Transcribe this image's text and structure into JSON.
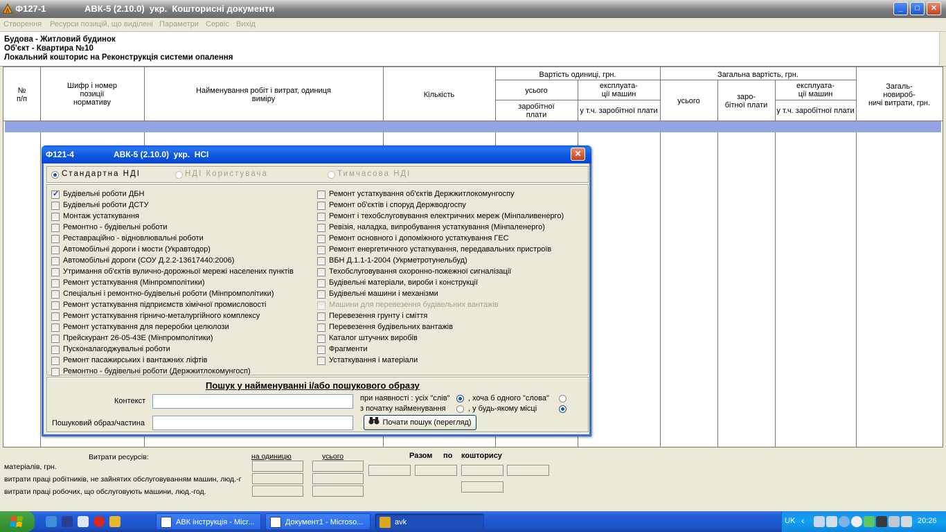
{
  "main_window": {
    "app_code": "Ф127-1",
    "title": "АВК-5 (2.10.0)  укр.  Кошторисні документи",
    "controls": {
      "minimize": "_",
      "maximize": "□",
      "close": "✕"
    }
  },
  "menu": [
    "Створення",
    "Ресурси позицій, що виділені",
    "Параметри",
    "Сервіс",
    "Вихід"
  ],
  "header": {
    "line1": "Будова - Житловий будинок",
    "line2": "Об'єкт - Квартира №10",
    "line3": "Локальний кошторис на Реконструкція системи опалення"
  },
  "table": {
    "col_num": [
      "№",
      "п/п"
    ],
    "col_code": [
      "Шифр і номер",
      "позиції",
      "нормативу"
    ],
    "col_name": [
      "Найменування робіт і витрат, одиниця",
      "виміру"
    ],
    "col_qty": "Кількість",
    "unit_cost": "Вартість одиниці, грн.",
    "total_cost": "Загальна вартість, грн.",
    "all": "усього",
    "machine_op": [
      "експлуата-",
      "ції машин"
    ],
    "wages": [
      "заробітної",
      "плати"
    ],
    "incl_wages": "у т.ч. заробітної плати",
    "total_wages": [
      "заро-",
      "бітної плати"
    ],
    "general": [
      "Загаль-",
      "новироб-",
      "ничі витрати, грн."
    ]
  },
  "resources": {
    "title": "Витрати ресурсів:",
    "per_unit": "на одиницю",
    "total": "усього",
    "rows": [
      "матеріалів, грн.",
      "витрати праці робітників, не зайнятих обслуговуванням машин, люд.-г",
      "витрати праці робочих, що обслуговують машини, люд.-год."
    ],
    "summary": [
      "Разом",
      "по",
      "кошторису"
    ]
  },
  "dialog": {
    "app_code": "Ф121-4",
    "title": "АВК-5 (2.10.0)  укр.  НСІ",
    "close": "✕",
    "sources": [
      {
        "label": "Стандартна НДІ",
        "selected": true,
        "enabled": true
      },
      {
        "label": "НДІ Користувача",
        "selected": false,
        "enabled": false
      },
      {
        "label": "Тимчасова НДІ",
        "selected": false,
        "enabled": false
      }
    ],
    "left_items": [
      {
        "label": "Будівельні роботи ДБН",
        "checked": true
      },
      {
        "label": "Будівельні роботи ДСТУ",
        "checked": false
      },
      {
        "label": "Монтаж устаткування",
        "checked": false
      },
      {
        "label": "Ремонтно - будівельні роботи",
        "checked": false
      },
      {
        "label": "Реставраційно - відновлювальні роботи",
        "checked": false
      },
      {
        "label": "Автомобільні дороги і мости (Укравтодор)",
        "checked": false
      },
      {
        "label": "Автомобільні дороги (СОУ Д.2.2-13617440:2006)",
        "checked": false
      },
      {
        "label": "Утримання об'єктів вулично-дорожньої мережі населених пунктів",
        "checked": false
      },
      {
        "label": "Ремонт устаткування (Мінпромполітики)",
        "checked": false
      },
      {
        "label": "Спеціальні і ремонтно-будівельні роботи (Мінпромполітики)",
        "checked": false
      },
      {
        "label": "Ремонт устаткування підприємств хімічної промисловості",
        "checked": false
      },
      {
        "label": "Ремонт устаткування  гірничо-металургійного комплексу",
        "checked": false
      },
      {
        "label": "Ремонт устаткування для переробки целюлози",
        "checked": false
      },
      {
        "label": "Прейскурант 26-05-43Е (Мінпромполітики)",
        "checked": false
      },
      {
        "label": "Пусконалагоджувальні роботи",
        "checked": false
      },
      {
        "label": "Ремонт пасажирських і вантажних ліфтів",
        "checked": false
      },
      {
        "label": "Ремонтно - будівельні роботи (Держжитлокомунгосп)",
        "checked": false
      }
    ],
    "right_items": [
      {
        "label": "Ремонт устаткування об'єктів Держжитлокомунгоспу",
        "checked": false,
        "enabled": true
      },
      {
        "label": "Ремонт об'єктів і споруд Держводгоспу",
        "checked": false,
        "enabled": true
      },
      {
        "label": "Ремонт і техобслуговування електричних мереж (Мінпаливенерго)",
        "checked": false,
        "enabled": true
      },
      {
        "label": "Ревізія, наладка, випробування устаткування (Мінпаленерго)",
        "checked": false,
        "enabled": true
      },
      {
        "label": "Ремонт основного і допоміжного устаткування ГЕС",
        "checked": false,
        "enabled": true
      },
      {
        "label": "Ремонт енергетичного устаткування, передавальних пристроїв",
        "checked": false,
        "enabled": true
      },
      {
        "label": "ВБН Д.1.1-1-2004 (Укрметротунельбуд)",
        "checked": false,
        "enabled": true
      },
      {
        "label": "Техобслуговування охоронно-пожежної сигналізації",
        "checked": false,
        "enabled": true
      },
      {
        "label": "Будівельні матеріали, вироби і конструкції",
        "checked": false,
        "enabled": true
      },
      {
        "label": "Будівельні машини і механізми",
        "checked": false,
        "enabled": true
      },
      {
        "label": "Машини для перевезення будівельних вантажів",
        "checked": false,
        "enabled": false
      },
      {
        "label": "Перевезення грунту і сміття",
        "checked": false,
        "enabled": true
      },
      {
        "label": "Перевезення будівельних вантажів",
        "checked": false,
        "enabled": true
      },
      {
        "label": "Каталог штучних виробів",
        "checked": false,
        "enabled": true
      },
      {
        "label": "Фрагменти",
        "checked": false,
        "enabled": true
      },
      {
        "label": "Устаткування і матеріали",
        "checked": false,
        "enabled": true
      }
    ],
    "search": {
      "title": "Пошук у найменуванні і/або пошукового образу",
      "context_label": "Контекст",
      "context_value": "",
      "pattern_label": "Пошуковий образ/частина",
      "pattern_value": "",
      "opt_all_words": "при наявності : усіх \"слів\"",
      "opt_any_word": ", хоча б одного \"слова\"",
      "opt_from_start": "з початку найменування",
      "opt_anywhere": ", у будь-якому місці",
      "all_words_selected": true,
      "anywhere_selected": true,
      "button": "Почати пошук (перегляд)"
    }
  },
  "taskbar": {
    "tasks": [
      {
        "label": "АВК інструкція - Micr...",
        "active": false
      },
      {
        "label": "Документ1 - Microso...",
        "active": false
      },
      {
        "label": "avk",
        "active": true
      }
    ],
    "lang": "UK",
    "time": "20:26"
  }
}
